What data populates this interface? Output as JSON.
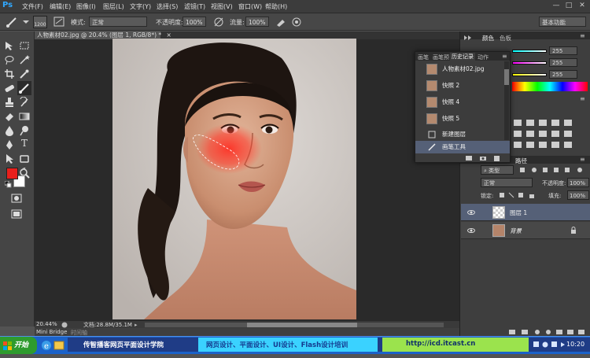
{
  "app": {
    "logo": "Ps"
  },
  "menubar": {
    "items": [
      "文件(F)",
      "编辑(E)",
      "图像(I)",
      "图层(L)",
      "文字(Y)",
      "选择(S)",
      "滤镜(T)",
      "视图(V)",
      "窗口(W)",
      "帮助(H)"
    ],
    "controls": [
      "—",
      "□",
      "✕"
    ]
  },
  "options": {
    "brush_size": "1200",
    "mode_label": "模式:",
    "mode_value": "正常",
    "opacity_label": "不透明度:",
    "opacity_value": "100%",
    "flow_label": "流量:",
    "flow_value": "100%",
    "workspace": "基本功能"
  },
  "document": {
    "tab_title": "人物素材02.jpg @ 20.4% (图层 1, RGB/8*) *",
    "tab_close": "×"
  },
  "status": {
    "zoom": "20.44%",
    "doc_info": "文档:28.8M/35.1M"
  },
  "bottom_tabs": {
    "mini_bridge": "Mini Bridge",
    "timeline": "时间轴"
  },
  "color_panel": {
    "tabs": [
      "颜色",
      "色板"
    ],
    "values": [
      "255",
      "255",
      "255"
    ]
  },
  "history_panel": {
    "tabs": [
      "画笔",
      "画笔预",
      "历史记录",
      "动作"
    ],
    "items": [
      {
        "label": "人物素材02.jpg",
        "type": "snapshot"
      },
      {
        "label": "快照 2",
        "type": "snapshot"
      },
      {
        "label": "快照 4",
        "type": "snapshot"
      },
      {
        "label": "快照 5",
        "type": "snapshot"
      },
      {
        "label": "新建图层",
        "type": "step"
      },
      {
        "label": "画笔工具",
        "type": "step"
      }
    ]
  },
  "layers_panel": {
    "tabs": [
      "路径"
    ],
    "filter": "类型",
    "blend_mode": "正常",
    "opacity_label": "不透明度:",
    "opacity_value": "100%",
    "lock_label": "锁定:",
    "fill_label": "填充:",
    "fill_value": "100%",
    "layers": [
      {
        "name": "图层 1",
        "selected": true
      },
      {
        "name": "背景",
        "selected": false
      }
    ]
  },
  "taskbar": {
    "start_label": "开始",
    "banner_title": "传智播客网页平面设计学院",
    "banner_courses": "网页设计、平面设计、UI设计、Flash设计培训",
    "banner_url": "http://icd.itcast.cn",
    "clock": "10:20"
  },
  "colors": {
    "foreground": "#e8201c",
    "background": "#ffffff",
    "accent": "#31a8ff"
  }
}
